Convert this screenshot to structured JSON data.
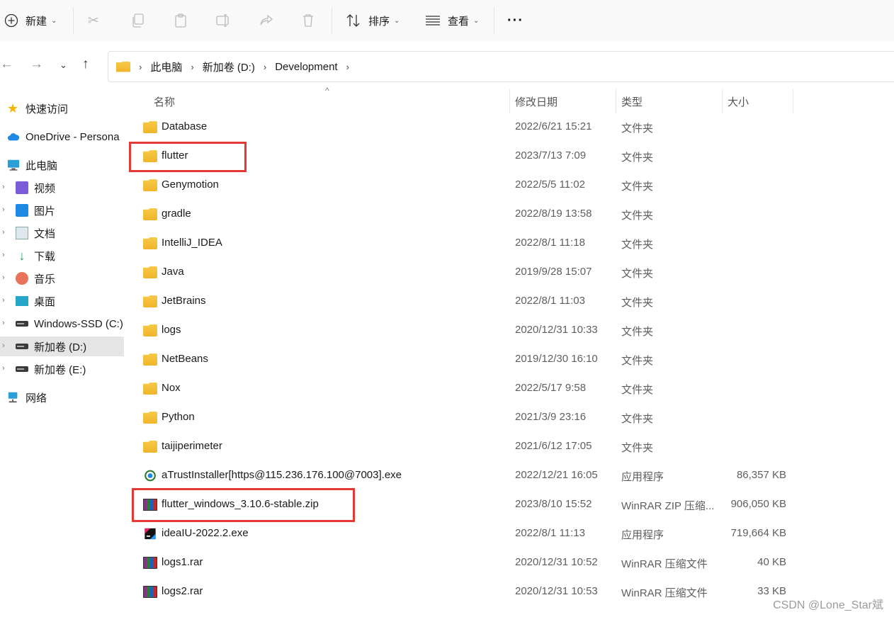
{
  "toolbar": {
    "new_label": "新建",
    "sort_label": "排序",
    "view_label": "查看",
    "more_label": "···"
  },
  "address": {
    "crumbs": [
      "此电脑",
      "新加卷 (D:)",
      "Development"
    ]
  },
  "sidebar": {
    "items": [
      {
        "label": "快速访问"
      },
      {
        "label": "OneDrive - Persona"
      },
      {
        "label": "此电脑"
      },
      {
        "label": "视频"
      },
      {
        "label": "图片"
      },
      {
        "label": "文档"
      },
      {
        "label": "下载"
      },
      {
        "label": "音乐"
      },
      {
        "label": "桌面"
      },
      {
        "label": "Windows-SSD (C:)"
      },
      {
        "label": "新加卷 (D:)"
      },
      {
        "label": "新加卷 (E:)"
      },
      {
        "label": "网络"
      }
    ]
  },
  "columns": {
    "name": "名称",
    "date": "修改日期",
    "type": "类型",
    "size": "大小"
  },
  "files": [
    {
      "name": "Database",
      "date": "2022/6/21 15:21",
      "type": "文件夹",
      "size": ""
    },
    {
      "name": "flutter",
      "date": "2023/7/13 7:09",
      "type": "文件夹",
      "size": ""
    },
    {
      "name": "Genymotion",
      "date": "2022/5/5 11:02",
      "type": "文件夹",
      "size": ""
    },
    {
      "name": "gradle",
      "date": "2022/8/19 13:58",
      "type": "文件夹",
      "size": ""
    },
    {
      "name": "IntelliJ_IDEA",
      "date": "2022/8/1 11:18",
      "type": "文件夹",
      "size": ""
    },
    {
      "name": "Java",
      "date": "2019/9/28 15:07",
      "type": "文件夹",
      "size": ""
    },
    {
      "name": "JetBrains",
      "date": "2022/8/1 11:03",
      "type": "文件夹",
      "size": ""
    },
    {
      "name": "logs",
      "date": "2020/12/31 10:33",
      "type": "文件夹",
      "size": ""
    },
    {
      "name": "NetBeans",
      "date": "2019/12/30 16:10",
      "type": "文件夹",
      "size": ""
    },
    {
      "name": "Nox",
      "date": "2022/5/17 9:58",
      "type": "文件夹",
      "size": ""
    },
    {
      "name": "Python",
      "date": "2021/3/9 23:16",
      "type": "文件夹",
      "size": ""
    },
    {
      "name": "taijiperimeter",
      "date": "2021/6/12 17:05",
      "type": "文件夹",
      "size": ""
    },
    {
      "name": "aTrustInstaller[https@115.236.176.100@7003].exe",
      "date": "2022/12/21 16:05",
      "type": "应用程序",
      "size": "86,357 KB"
    },
    {
      "name": "flutter_windows_3.10.6-stable.zip",
      "date": "2023/8/10 15:52",
      "type": "WinRAR ZIP 压缩...",
      "size": "906,050 KB"
    },
    {
      "name": "ideaIU-2022.2.exe",
      "date": "2022/8/1 11:13",
      "type": "应用程序",
      "size": "719,664 KB"
    },
    {
      "name": "logs1.rar",
      "date": "2020/12/31 10:52",
      "type": "WinRAR 压缩文件",
      "size": "40 KB"
    },
    {
      "name": "logs2.rar",
      "date": "2020/12/31 10:53",
      "type": "WinRAR 压缩文件",
      "size": "33 KB"
    }
  ],
  "watermark": "CSDN @Lone_Star斌"
}
